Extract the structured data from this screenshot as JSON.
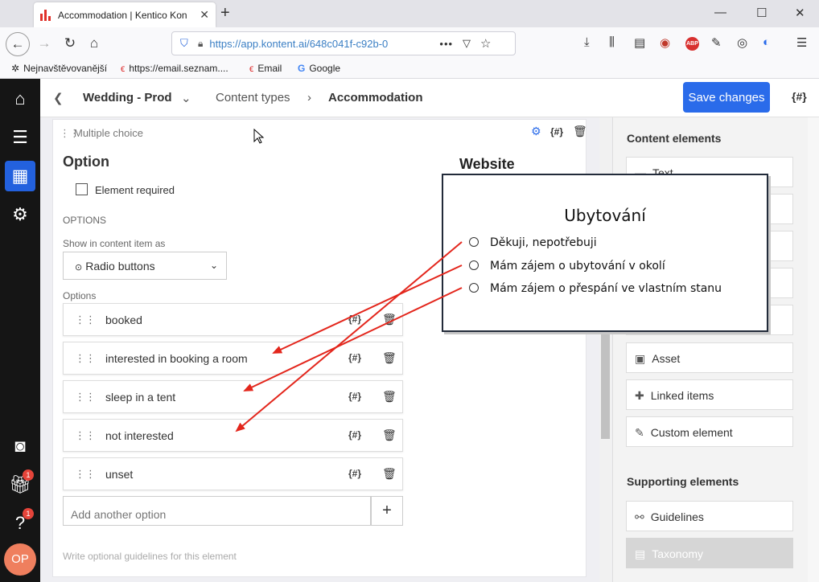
{
  "browser": {
    "tab_title": "Accommodation | Kentico Kon",
    "url": "https://app.kontent.ai/648c041f-c92b-0",
    "bookmarks": [
      "Nejnavštěvovanější",
      "https://email.seznam....",
      "Email",
      "Google"
    ],
    "abp_label": "ABP"
  },
  "header": {
    "project": "Wedding - Prod",
    "section": "Content types",
    "current": "Accommodation",
    "save_label": "Save changes",
    "codename_label": "{#}"
  },
  "element": {
    "type_label": "Multiple choice",
    "name": "Option",
    "required_label": "Element required",
    "options_section": "OPTIONS",
    "show_as_label": "Show in content item as",
    "show_as_value": "Radio buttons",
    "options_label": "Options",
    "options": [
      "booked",
      "interested in booking a room",
      "sleep in a tent",
      "not interested",
      "unset"
    ],
    "add_placeholder": "Add another option",
    "guidelines_placeholder": "Write optional guidelines for this element",
    "website_label": "Website"
  },
  "right_panel": {
    "content_heading": "Content elements",
    "content_items": [
      "Text",
      "Asset",
      "Linked items",
      "Custom element"
    ],
    "supporting_heading": "Supporting elements",
    "supporting_items": [
      "Guidelines",
      "Taxonomy"
    ]
  },
  "overlay": {
    "title": "Ubytování",
    "options": [
      "Děkuji, nepotřebuji",
      "Mám zájem o ubytování v okolí",
      "Mám zájem o přespání ve vlastním stanu"
    ]
  },
  "nav": {
    "avatar": "OP",
    "badge_gift": "1",
    "badge_help": "1"
  },
  "colors": {
    "accent": "#2a6bea",
    "arrow": "#e3261c",
    "sidebar": "#151515"
  }
}
